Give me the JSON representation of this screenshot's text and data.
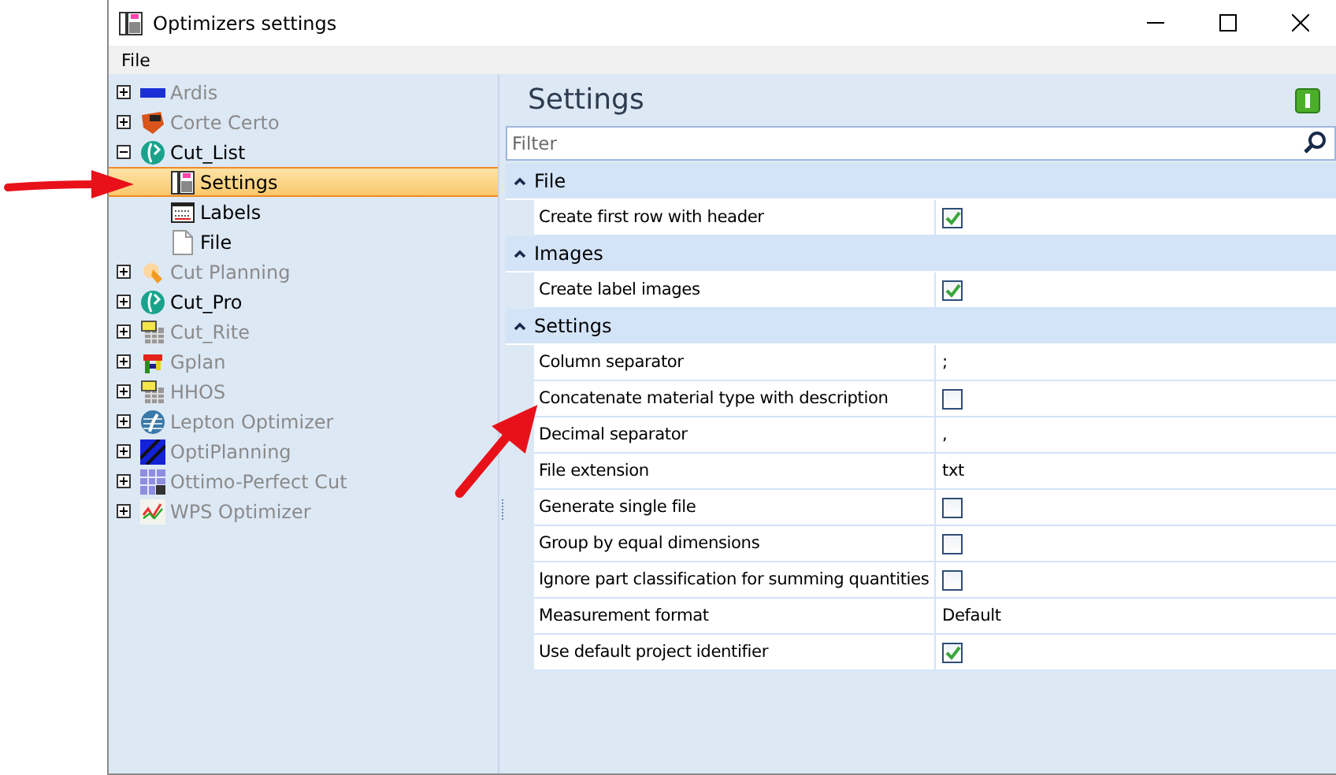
{
  "window": {
    "title": "Optimizers settings"
  },
  "menu": [
    "File"
  ],
  "tree": [
    {
      "label": "Ardis",
      "expanded": false,
      "disabled": true
    },
    {
      "label": "Corte Certo",
      "expanded": false,
      "disabled": true
    },
    {
      "label": "Cut_List",
      "expanded": true,
      "disabled": false,
      "children": [
        {
          "label": "Settings",
          "selected": true
        },
        {
          "label": "Labels",
          "selected": false
        },
        {
          "label": "File",
          "selected": false
        }
      ]
    },
    {
      "label": "Cut Planning",
      "expanded": false,
      "disabled": true
    },
    {
      "label": "Cut_Pro",
      "expanded": false,
      "disabled": false
    },
    {
      "label": "Cut_Rite",
      "expanded": false,
      "disabled": true
    },
    {
      "label": "Gplan",
      "expanded": false,
      "disabled": true
    },
    {
      "label": "HHOS",
      "expanded": false,
      "disabled": true
    },
    {
      "label": "Lepton Optimizer",
      "expanded": false,
      "disabled": true
    },
    {
      "label": "OptiPlanning",
      "expanded": false,
      "disabled": true
    },
    {
      "label": "Ottimo-Perfect Cut",
      "expanded": false,
      "disabled": true
    },
    {
      "label": "WPS Optimizer",
      "expanded": false,
      "disabled": true
    }
  ],
  "panel": {
    "title": "Settings",
    "filter": {
      "placeholder": "Filter"
    }
  },
  "groups": [
    {
      "title": "File",
      "expanded": true,
      "rows": [
        {
          "label": "Create first row with header",
          "kind": "check",
          "checked": true
        }
      ]
    },
    {
      "title": "Images",
      "expanded": true,
      "rows": [
        {
          "label": "Create label images",
          "kind": "check",
          "checked": true
        }
      ]
    },
    {
      "title": "Settings",
      "expanded": true,
      "rows": [
        {
          "label": "Column separator",
          "kind": "text",
          "value": ";"
        },
        {
          "label": "Concatenate material type with description",
          "kind": "check",
          "checked": false
        },
        {
          "label": "Decimal separator",
          "kind": "text",
          "value": ","
        },
        {
          "label": "File extension",
          "kind": "text",
          "value": "txt"
        },
        {
          "label": "Generate single file",
          "kind": "check",
          "checked": false
        },
        {
          "label": "Group by equal dimensions",
          "kind": "check",
          "checked": false
        },
        {
          "label": "Ignore part classification for summing quantities",
          "kind": "check",
          "checked": false
        },
        {
          "label": "Measurement format",
          "kind": "text",
          "value": "Default"
        },
        {
          "label": "Use default project identifier",
          "kind": "check",
          "checked": true
        }
      ]
    }
  ]
}
